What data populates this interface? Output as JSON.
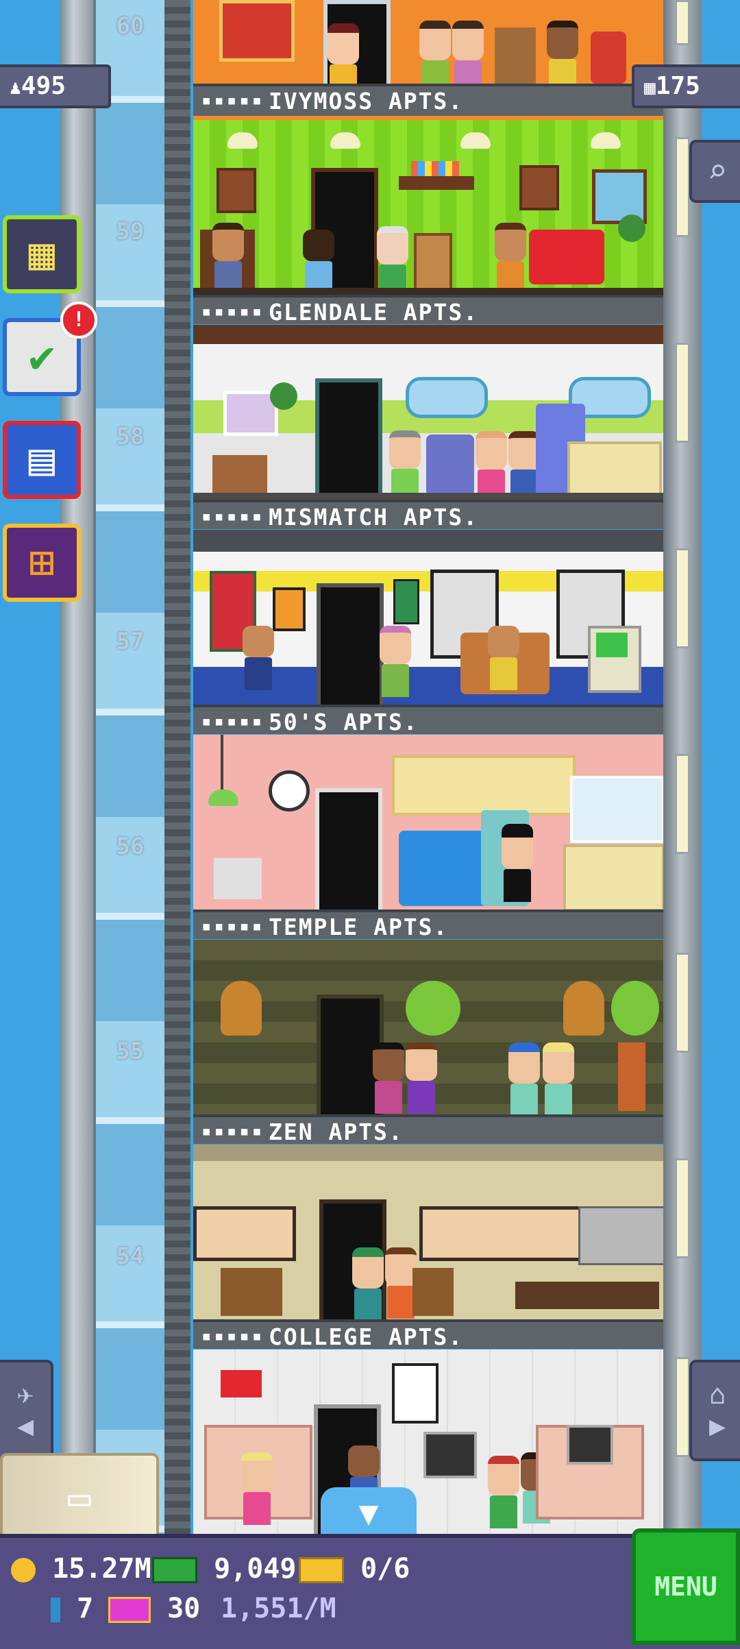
{
  "floors": [
    {
      "number": "60",
      "name": "IVYMOSS APTS."
    },
    {
      "number": "59",
      "name": "GLENDALE APTS."
    },
    {
      "number": "58",
      "name": "MISMATCH APTS."
    },
    {
      "number": "57",
      "name": "50'S APTS."
    },
    {
      "number": "56",
      "name": "TEMPLE APTS."
    },
    {
      "number": "55",
      "name": "ZEN APTS."
    },
    {
      "number": "54",
      "name": "COLLEGE APTS."
    }
  ],
  "status": {
    "population": "495",
    "floor_count": "175",
    "notification_count": "!"
  },
  "hud": {
    "coins": "15.27M",
    "bux": "9,049",
    "vip_tickets": "0/6",
    "stock": "7",
    "tower_bux": "30",
    "income": "1,551/M",
    "menu_label": "MENU"
  },
  "colors": {
    "sky": "#3da3e3",
    "hud": "#544d83",
    "menu_green": "#1fb42c"
  },
  "icons": [
    "population-icon",
    "floor-icon",
    "search-icon",
    "tower-calendar-icon",
    "missions-icon",
    "calendar-icon",
    "gift-icon",
    "elevator-person-icon",
    "home-icon",
    "storage-box-icon",
    "coin-icon",
    "bux-icon",
    "vip-ticket-icon",
    "stock-icon",
    "tower-bux-icon",
    "down-arrow-icon"
  ]
}
